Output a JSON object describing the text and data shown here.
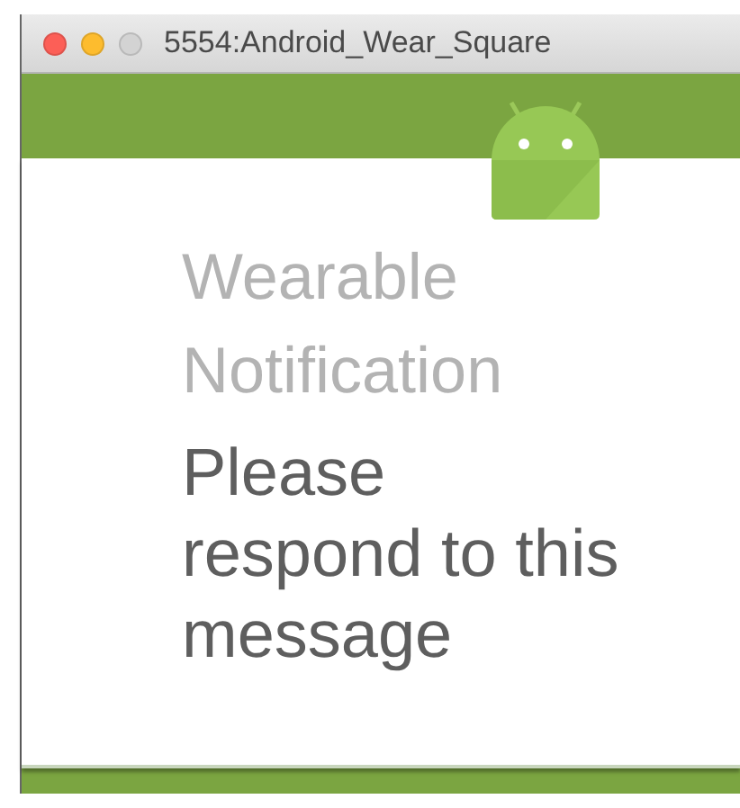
{
  "window": {
    "title": "5554:Android_Wear_Square",
    "controls": [
      {
        "kind": "close",
        "disabled": false
      },
      {
        "kind": "minimize",
        "disabled": false
      },
      {
        "kind": "zoom",
        "disabled": true
      }
    ]
  },
  "notification": {
    "title": "Wearable Notification",
    "text": "Please respond to this message"
  }
}
